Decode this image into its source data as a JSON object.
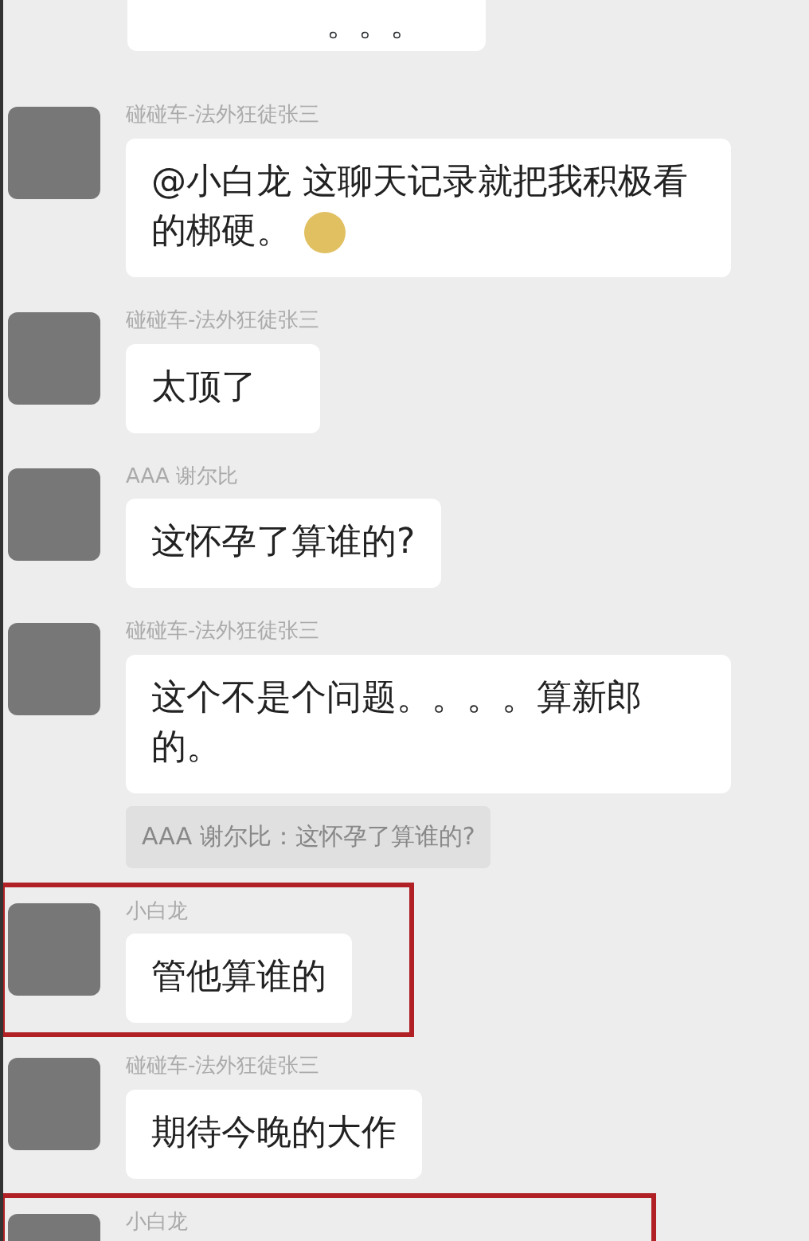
{
  "partial_top_message": {
    "text": "。。。"
  },
  "messages": [
    {
      "sender": "碰碰车-法外狂徒张三",
      "text": "@小白龙 这聊天记录就把我积极看的梆硬。",
      "emoji": true,
      "highlighted": false
    },
    {
      "sender": "碰碰车-法外狂徒张三",
      "text": "太顶了",
      "emoji": false,
      "highlighted": false
    },
    {
      "sender": "AAA 谢尔比",
      "text": "这怀孕了算谁的?",
      "emoji": false,
      "highlighted": false
    },
    {
      "sender": "碰碰车-法外狂徒张三",
      "text": "这个不是个问题。。。。算新郎的。",
      "emoji": false,
      "highlighted": false,
      "quote": "AAA 谢尔比：这怀孕了算谁的?"
    },
    {
      "sender": "小白龙",
      "text": "管他算谁的",
      "emoji": false,
      "highlighted": true
    },
    {
      "sender": "碰碰车-法外狂徒张三",
      "text": "期待今晚的大作",
      "emoji": false,
      "highlighted": false
    },
    {
      "sender": "小白龙",
      "highlighted": true
    }
  ]
}
